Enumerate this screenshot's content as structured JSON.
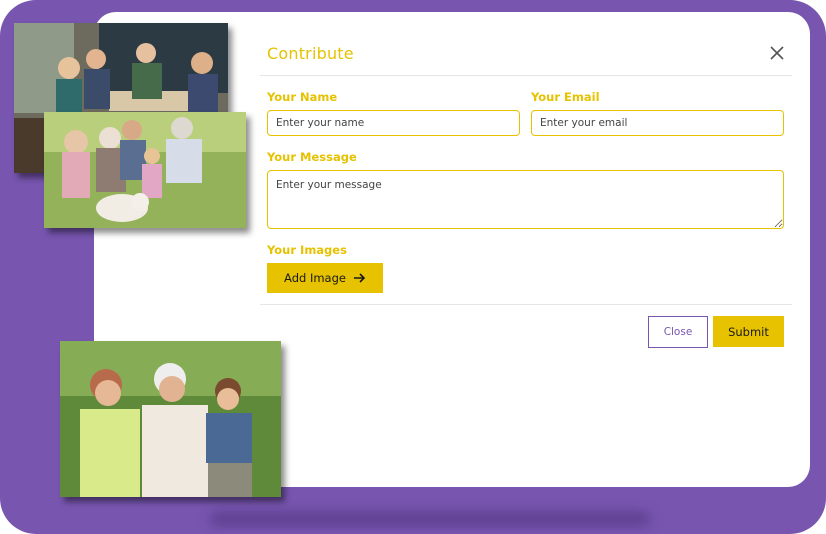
{
  "colors": {
    "frame": "#7856b0",
    "accent": "#e6c200",
    "title": "#e6c200",
    "close_border": "#7856b0",
    "close_text": "#7856b0"
  },
  "modal": {
    "title": "Contribute",
    "close_icon": "close-x-icon",
    "name_label": "Your Name",
    "name_placeholder": "Enter your name",
    "email_label": "Your Email",
    "email_placeholder": "Enter your email",
    "message_label": "Your Message",
    "message_placeholder": "Enter your message",
    "images_label": "Your Images",
    "add_image_label": "Add Image",
    "add_image_icon": "arrow-right-icon",
    "close_button": "Close",
    "submit_button": "Submit"
  },
  "photos": [
    {
      "subject": "family-dinner-photo"
    },
    {
      "subject": "family-outdoor-dog-photo"
    },
    {
      "subject": "grandfather-mother-child-photo"
    }
  ]
}
